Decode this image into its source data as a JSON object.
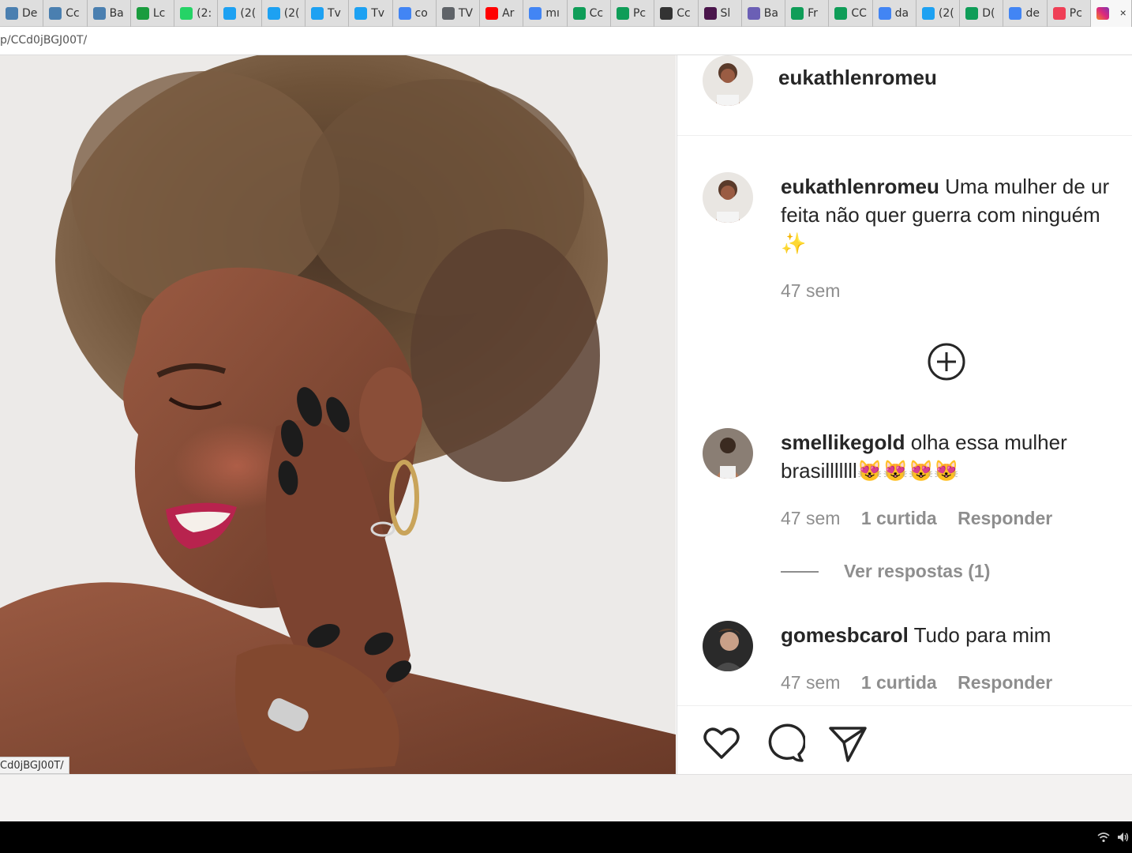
{
  "browser": {
    "tabs": [
      {
        "title": "De",
        "favicon": "chart-icon",
        "color": "#4a7fb0"
      },
      {
        "title": "Cc",
        "favicon": "chart-icon",
        "color": "#4a7fb0"
      },
      {
        "title": "Ba",
        "favicon": "chart-icon",
        "color": "#4a7fb0"
      },
      {
        "title": "Lc",
        "favicon": "brazil-flag-icon",
        "color": "#1a9c3e"
      },
      {
        "title": "(2:",
        "favicon": "whatsapp-icon",
        "color": "#25d366"
      },
      {
        "title": "(2(",
        "favicon": "twitter-icon",
        "color": "#1da1f2"
      },
      {
        "title": "(2(",
        "favicon": "twitter-icon",
        "color": "#1da1f2"
      },
      {
        "title": "Tv",
        "favicon": "twitter-icon",
        "color": "#1da1f2"
      },
      {
        "title": "Tv",
        "favicon": "twitter-icon",
        "color": "#1da1f2"
      },
      {
        "title": "co",
        "favicon": "google-icon",
        "color": "#4285f4"
      },
      {
        "title": "TV",
        "favicon": "globe-icon",
        "color": "#5f6368"
      },
      {
        "title": "Ar",
        "favicon": "youtube-icon",
        "color": "#ff0000"
      },
      {
        "title": "mı",
        "favicon": "google-icon",
        "color": "#4285f4"
      },
      {
        "title": "Cc",
        "favicon": "sheet-icon",
        "color": "#0f9d58"
      },
      {
        "title": "Pc",
        "favicon": "sheet-icon",
        "color": "#0f9d58"
      },
      {
        "title": "Cc",
        "favicon": "circle-icon",
        "color": "#333333"
      },
      {
        "title": "Sl",
        "favicon": "slack-icon",
        "color": "#4a154b"
      },
      {
        "title": "Ba",
        "favicon": "globe-icon",
        "color": "#6b5fb5"
      },
      {
        "title": "Fr",
        "favicon": "sheet-icon",
        "color": "#0f9d58"
      },
      {
        "title": "CC",
        "favicon": "sheet-icon",
        "color": "#0f9d58"
      },
      {
        "title": "da",
        "favicon": "google-icon",
        "color": "#4285f4"
      },
      {
        "title": "(2(",
        "favicon": "twitter-icon",
        "color": "#1da1f2"
      },
      {
        "title": "D(",
        "favicon": "sheet-icon",
        "color": "#0f9d58"
      },
      {
        "title": "de",
        "favicon": "google-icon",
        "color": "#4285f4"
      },
      {
        "title": "Pc",
        "favicon": "pocket-icon",
        "color": "#ef3f56"
      }
    ],
    "active_tab": {
      "favicon": "instagram-icon",
      "close": "×"
    },
    "url_fragment": "p/CCd0jBGJ00T/",
    "status_link": "Cd0jBGJ00T/"
  },
  "post": {
    "header": {
      "username": "eukathlenromeu"
    },
    "caption": {
      "username": "eukathlenromeu",
      "line1": "Uma mulher de ur",
      "line2": "feita não quer guerra com ninguém",
      "line3": "✨",
      "time": "47 sem"
    },
    "comments": [
      {
        "username": "smellikegold",
        "line1": "olha essa mulher",
        "line2": "brasilllllll😻😻😻😻",
        "time": "47 sem",
        "likes": "1 curtida",
        "reply": "Responder",
        "view_replies": "Ver respostas (1)"
      },
      {
        "username": "gomesbcarol",
        "line1": "Tudo para mim",
        "time": "47 sem",
        "likes": "1 curtida",
        "reply": "Responder"
      }
    ],
    "actions": [
      "heart-icon",
      "comment-icon",
      "share-icon"
    ]
  },
  "colors": {
    "text": "#262626",
    "muted": "#8e8e8e",
    "divider": "#efefef"
  }
}
